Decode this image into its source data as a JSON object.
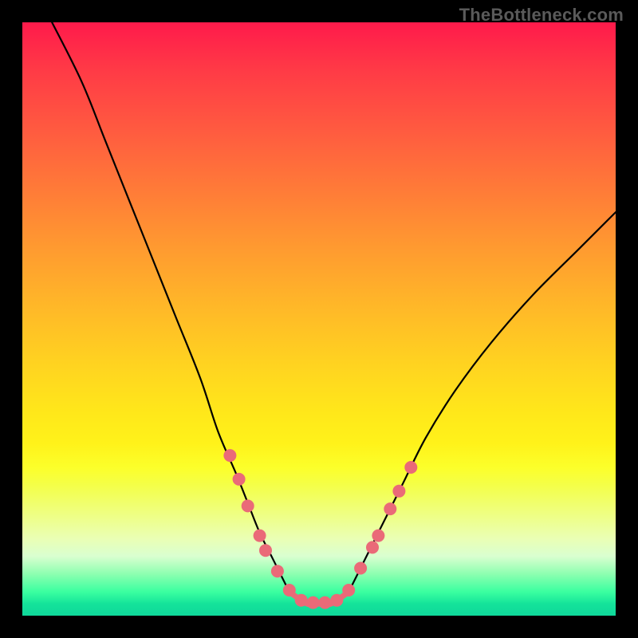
{
  "watermark": "TheBottleneck.com",
  "chart_data": {
    "type": "line",
    "title": "",
    "xlabel": "",
    "ylabel": "",
    "xlim": [
      0,
      100
    ],
    "ylim": [
      0,
      100
    ],
    "series": [
      {
        "name": "left-descent",
        "x": [
          5,
          10,
          14,
          18,
          22,
          26,
          30,
          33,
          36,
          38,
          40,
          42,
          44,
          45
        ],
        "y": [
          100,
          90,
          80,
          70,
          60,
          50,
          40,
          31,
          24,
          19,
          14,
          10,
          6,
          4
        ]
      },
      {
        "name": "right-ascent",
        "x": [
          55,
          57,
          60,
          64,
          68,
          73,
          79,
          86,
          94,
          100
        ],
        "y": [
          4,
          8,
          14,
          22,
          30,
          38,
          46,
          54,
          62,
          68
        ]
      },
      {
        "name": "valley-floor",
        "x": [
          45,
          48,
          50,
          52,
          55
        ],
        "y": [
          4,
          2,
          2,
          2,
          4
        ]
      }
    ],
    "markers": {
      "color": "#ea6a78",
      "radius_px": 8,
      "left_branch": [
        {
          "x": 35,
          "y": 27
        },
        {
          "x": 36.5,
          "y": 23
        },
        {
          "x": 38,
          "y": 18.5
        },
        {
          "x": 40,
          "y": 13.5
        },
        {
          "x": 41,
          "y": 11
        },
        {
          "x": 43,
          "y": 7.5
        }
      ],
      "right_branch": [
        {
          "x": 57,
          "y": 8
        },
        {
          "x": 59,
          "y": 11.5
        },
        {
          "x": 60,
          "y": 13.5
        },
        {
          "x": 62,
          "y": 18
        },
        {
          "x": 63.5,
          "y": 21
        },
        {
          "x": 65.5,
          "y": 25
        }
      ],
      "floor": [
        {
          "x": 45,
          "y": 4.3
        },
        {
          "x": 47,
          "y": 2.6
        },
        {
          "x": 49,
          "y": 2.2
        },
        {
          "x": 51,
          "y": 2.2
        },
        {
          "x": 53,
          "y": 2.6
        },
        {
          "x": 55,
          "y": 4.3
        }
      ]
    },
    "gradient_stops": [
      {
        "pos": 0.0,
        "color": "#ff1a4b"
      },
      {
        "pos": 0.38,
        "color": "#ff9a30"
      },
      {
        "pos": 0.66,
        "color": "#ffe81a"
      },
      {
        "pos": 0.9,
        "color": "#d9ffd0"
      },
      {
        "pos": 1.0,
        "color": "#0fd89a"
      }
    ]
  }
}
